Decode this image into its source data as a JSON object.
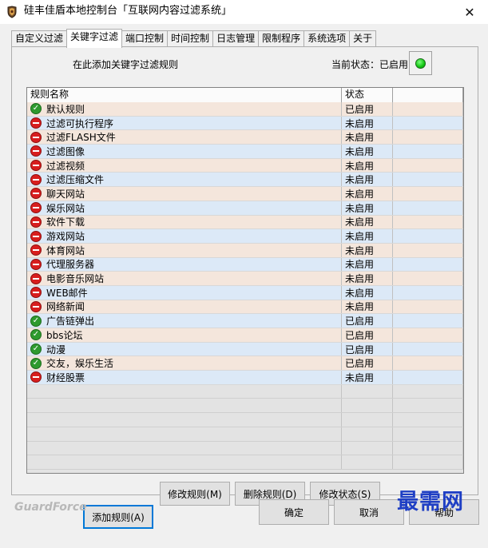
{
  "window": {
    "title": "硅丰佳盾本地控制台「互联网内容过滤系统」",
    "close_glyph": "✕"
  },
  "tabs": [
    {
      "label": "自定义过滤",
      "active": false
    },
    {
      "label": "关键字过滤",
      "active": true
    },
    {
      "label": "端口控制",
      "active": false
    },
    {
      "label": "时间控制",
      "active": false
    },
    {
      "label": "日志管理",
      "active": false
    },
    {
      "label": "限制程序",
      "active": false
    },
    {
      "label": "系统选项",
      "active": false
    },
    {
      "label": "关于",
      "active": false
    }
  ],
  "panel": {
    "hint": "在此添加关键字过滤规则",
    "status_label": "当前状态：已启用",
    "status_color": "#12c412"
  },
  "table": {
    "headers": [
      "规则名称",
      "状态",
      ""
    ],
    "rows": [
      {
        "name": "默认规则",
        "status": "已启用",
        "enabled": true
      },
      {
        "name": "过滤可执行程序",
        "status": "未启用",
        "enabled": false
      },
      {
        "name": "过滤FLASH文件",
        "status": "未启用",
        "enabled": false
      },
      {
        "name": "过滤图像",
        "status": "未启用",
        "enabled": false
      },
      {
        "name": "过滤视频",
        "status": "未启用",
        "enabled": false
      },
      {
        "name": "过滤压缩文件",
        "status": "未启用",
        "enabled": false
      },
      {
        "name": "聊天网站",
        "status": "未启用",
        "enabled": false
      },
      {
        "name": "娱乐网站",
        "status": "未启用",
        "enabled": false
      },
      {
        "name": "软件下载",
        "status": "未启用",
        "enabled": false
      },
      {
        "name": "游戏网站",
        "status": "未启用",
        "enabled": false
      },
      {
        "name": "体育网站",
        "status": "未启用",
        "enabled": false
      },
      {
        "name": "代理服务器",
        "status": "未启用",
        "enabled": false
      },
      {
        "name": "电影音乐网站",
        "status": "未启用",
        "enabled": false
      },
      {
        "name": "WEB邮件",
        "status": "未启用",
        "enabled": false
      },
      {
        "name": "网络新闻",
        "status": "未启用",
        "enabled": false
      },
      {
        "name": "广告链弹出",
        "status": "已启用",
        "enabled": true
      },
      {
        "name": "bbs论坛",
        "status": "已启用",
        "enabled": true
      },
      {
        "name": "动漫",
        "status": "已启用",
        "enabled": true
      },
      {
        "name": "交友，娱乐生活",
        "status": "已启用",
        "enabled": true
      },
      {
        "name": "财经股票",
        "status": "未启用",
        "enabled": false
      }
    ],
    "row_colors": [
      "#f4e6dc",
      "#dce9f7"
    ],
    "empty_rows": 6
  },
  "actions": {
    "add_rule": "添加规则(A)",
    "edit_rule": "修改规则(M)",
    "delete_rule": "删除规则(D)",
    "toggle_status": "修改状态(S)"
  },
  "footer": {
    "brand": "GuardForce",
    "ok": "确定",
    "cancel": "取消",
    "help": "帮助"
  },
  "watermark": "最需网"
}
